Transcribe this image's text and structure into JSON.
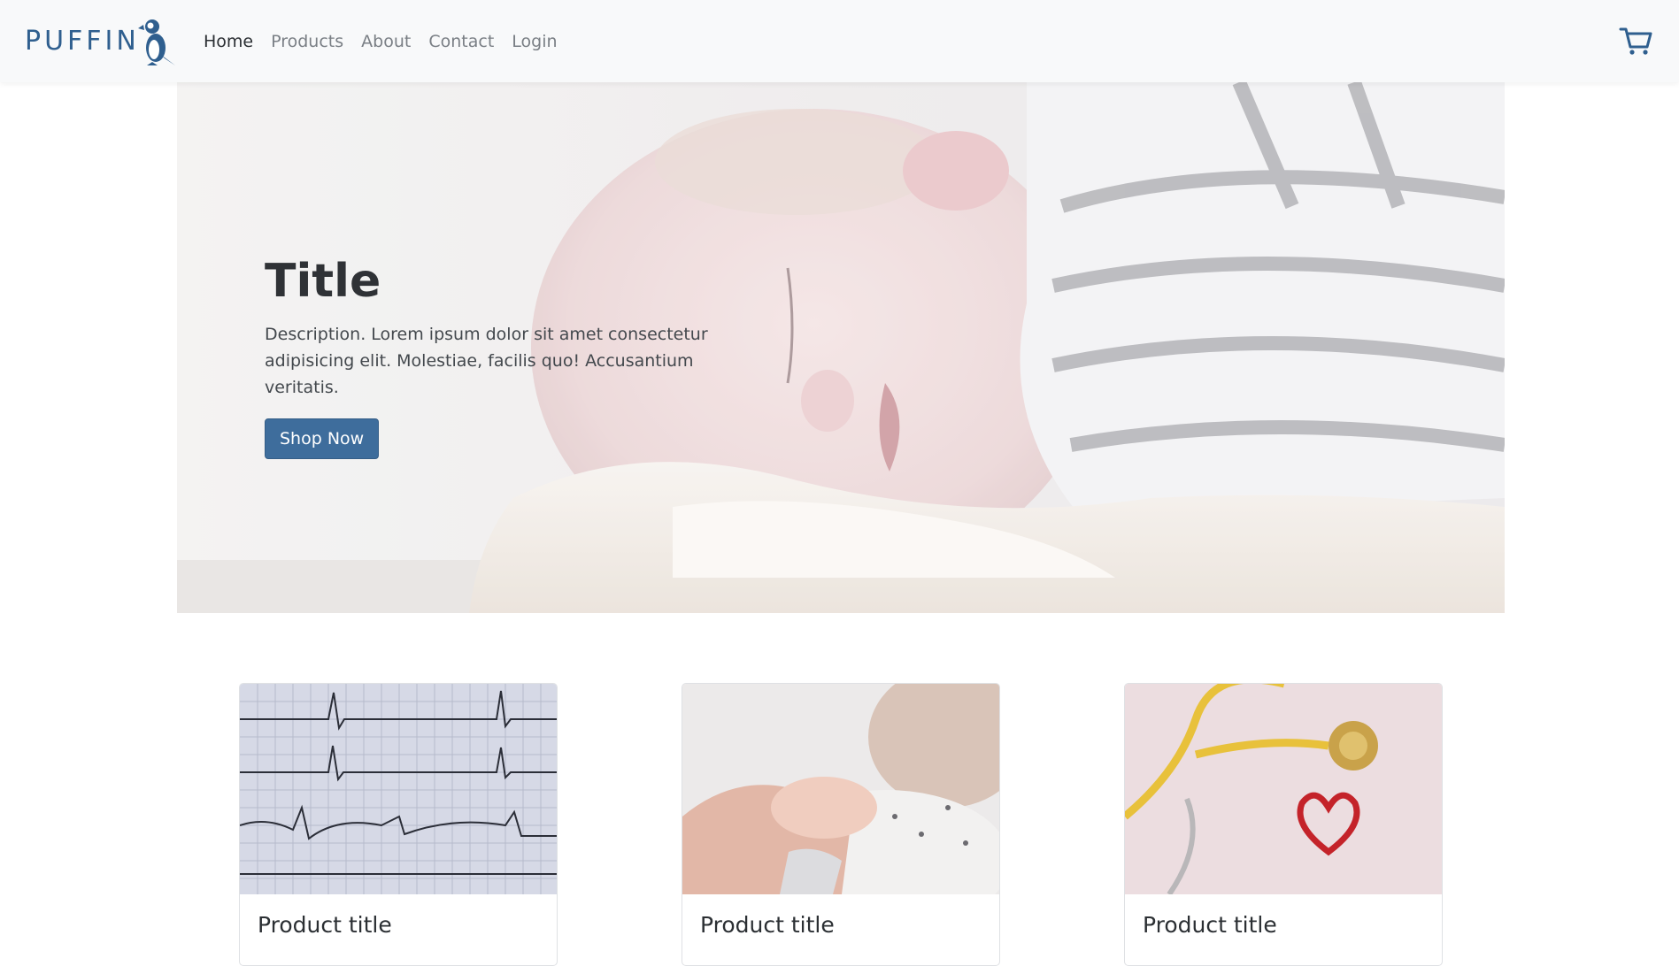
{
  "navbar": {
    "brand": "PUFFIN",
    "links": [
      {
        "label": "Home",
        "active": true
      },
      {
        "label": "Products",
        "active": false
      },
      {
        "label": "About",
        "active": false
      },
      {
        "label": "Contact",
        "active": false
      },
      {
        "label": "Login",
        "active": false
      }
    ],
    "cart_icon": "cart-icon"
  },
  "hero": {
    "title": "Title",
    "description": "Description. Lorem ipsum dolor sit amet consectetur adipisicing elit. Molestiae, facilis quo! Accusantium veritatis.",
    "button_label": "Shop Now",
    "image": "sleeping-baby-photo"
  },
  "products": [
    {
      "title": "Product title",
      "image": "ecg-strip-photo"
    },
    {
      "title": "Product title",
      "image": "baby-hand-photo"
    },
    {
      "title": "Product title",
      "image": "stethoscope-heart-photo"
    }
  ],
  "colors": {
    "brand": "#2f5f8f",
    "primary_button": "#3e6d9c",
    "navbar_bg": "#f8f9fa"
  }
}
